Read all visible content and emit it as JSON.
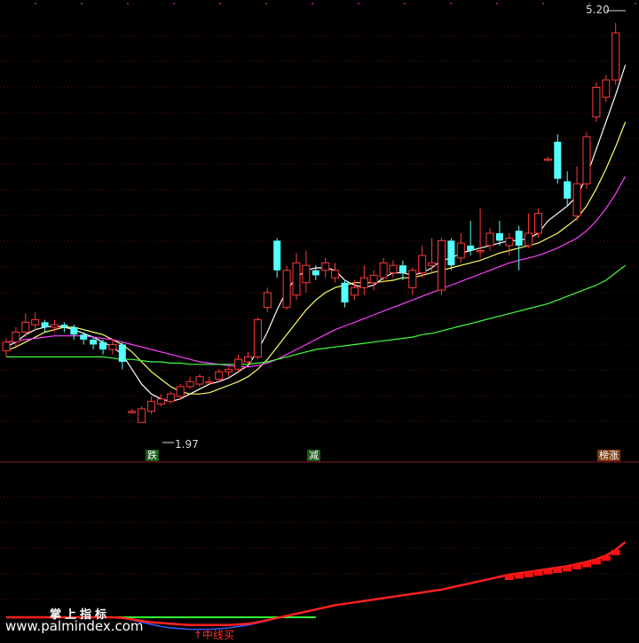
{
  "chart_data": {
    "type": "candlestick",
    "price_range": [
      1.8,
      5.3
    ],
    "annotations": {
      "high": "5.20",
      "low": "1.97"
    },
    "candles": [
      {
        "o": 2.55,
        "c": 2.62,
        "h": 2.65,
        "l": 2.5,
        "up": true
      },
      {
        "o": 2.62,
        "c": 2.7,
        "h": 2.74,
        "l": 2.58,
        "up": true
      },
      {
        "o": 2.7,
        "c": 2.78,
        "h": 2.85,
        "l": 2.66,
        "up": true
      },
      {
        "o": 2.76,
        "c": 2.8,
        "h": 2.86,
        "l": 2.72,
        "up": true
      },
      {
        "o": 2.78,
        "c": 2.74,
        "h": 2.8,
        "l": 2.7,
        "up": false
      },
      {
        "o": 2.74,
        "c": 2.76,
        "h": 2.8,
        "l": 2.7,
        "up": true
      },
      {
        "o": 2.76,
        "c": 2.74,
        "h": 2.78,
        "l": 2.7,
        "up": false
      },
      {
        "o": 2.74,
        "c": 2.68,
        "h": 2.76,
        "l": 2.64,
        "up": false
      },
      {
        "o": 2.68,
        "c": 2.64,
        "h": 2.7,
        "l": 2.6,
        "up": false
      },
      {
        "o": 2.64,
        "c": 2.6,
        "h": 2.66,
        "l": 2.56,
        "up": false
      },
      {
        "o": 2.62,
        "c": 2.56,
        "h": 2.64,
        "l": 2.52,
        "up": false
      },
      {
        "o": 2.56,
        "c": 2.6,
        "h": 2.64,
        "l": 2.52,
        "up": true
      },
      {
        "o": 2.6,
        "c": 2.46,
        "h": 2.62,
        "l": 2.4,
        "up": false
      },
      {
        "o": 2.06,
        "c": 2.06,
        "h": 2.08,
        "l": 2.04,
        "up": true
      },
      {
        "o": 1.97,
        "c": 2.08,
        "h": 2.1,
        "l": 1.97,
        "up": true
      },
      {
        "o": 2.06,
        "c": 2.14,
        "h": 2.18,
        "l": 2.04,
        "up": true
      },
      {
        "o": 2.12,
        "c": 2.16,
        "h": 2.2,
        "l": 2.1,
        "up": true
      },
      {
        "o": 2.14,
        "c": 2.2,
        "h": 2.22,
        "l": 2.12,
        "up": true
      },
      {
        "o": 2.18,
        "c": 2.26,
        "h": 2.28,
        "l": 2.16,
        "up": true
      },
      {
        "o": 2.26,
        "c": 2.3,
        "h": 2.34,
        "l": 2.24,
        "up": true
      },
      {
        "o": 2.28,
        "c": 2.34,
        "h": 2.36,
        "l": 2.26,
        "up": true
      },
      {
        "o": 2.3,
        "c": 2.3,
        "h": 2.34,
        "l": 2.28,
        "up": true
      },
      {
        "o": 2.32,
        "c": 2.38,
        "h": 2.4,
        "l": 2.3,
        "up": true
      },
      {
        "o": 2.38,
        "c": 2.4,
        "h": 2.42,
        "l": 2.34,
        "up": true
      },
      {
        "o": 2.4,
        "c": 2.48,
        "h": 2.52,
        "l": 2.38,
        "up": true
      },
      {
        "o": 2.46,
        "c": 2.5,
        "h": 2.54,
        "l": 2.44,
        "up": true
      },
      {
        "o": 2.5,
        "c": 2.8,
        "h": 2.82,
        "l": 2.48,
        "up": true
      },
      {
        "o": 2.9,
        "c": 3.02,
        "h": 3.06,
        "l": 2.86,
        "up": true
      },
      {
        "o": 3.44,
        "c": 3.2,
        "h": 3.46,
        "l": 3.14,
        "up": false
      },
      {
        "o": 2.9,
        "c": 3.2,
        "h": 3.24,
        "l": 2.88,
        "up": true
      },
      {
        "o": 3.0,
        "c": 3.26,
        "h": 3.34,
        "l": 2.96,
        "up": true
      },
      {
        "o": 3.1,
        "c": 3.24,
        "h": 3.36,
        "l": 3.02,
        "up": true
      },
      {
        "o": 3.2,
        "c": 3.16,
        "h": 3.24,
        "l": 3.12,
        "up": false
      },
      {
        "o": 3.2,
        "c": 3.26,
        "h": 3.3,
        "l": 3.14,
        "up": true
      },
      {
        "o": 3.14,
        "c": 3.2,
        "h": 3.26,
        "l": 3.1,
        "up": true
      },
      {
        "o": 3.1,
        "c": 2.94,
        "h": 3.12,
        "l": 2.9,
        "up": false
      },
      {
        "o": 3.0,
        "c": 3.06,
        "h": 3.12,
        "l": 2.96,
        "up": true
      },
      {
        "o": 3.06,
        "c": 3.14,
        "h": 3.24,
        "l": 3.0,
        "up": true
      },
      {
        "o": 3.1,
        "c": 3.16,
        "h": 3.2,
        "l": 3.04,
        "up": true
      },
      {
        "o": 3.14,
        "c": 3.26,
        "h": 3.3,
        "l": 3.1,
        "up": true
      },
      {
        "o": 3.18,
        "c": 3.24,
        "h": 3.28,
        "l": 3.14,
        "up": true
      },
      {
        "o": 3.24,
        "c": 3.18,
        "h": 3.28,
        "l": 3.12,
        "up": false
      },
      {
        "o": 3.06,
        "c": 3.2,
        "h": 3.22,
        "l": 3.0,
        "up": true
      },
      {
        "o": 3.18,
        "c": 3.32,
        "h": 3.4,
        "l": 3.14,
        "up": true
      },
      {
        "o": 3.24,
        "c": 3.26,
        "h": 3.46,
        "l": 3.18,
        "up": true
      },
      {
        "o": 3.04,
        "c": 3.44,
        "h": 3.46,
        "l": 3.0,
        "up": true
      },
      {
        "o": 3.44,
        "c": 3.24,
        "h": 3.46,
        "l": 3.2,
        "up": false
      },
      {
        "o": 3.3,
        "c": 3.42,
        "h": 3.5,
        "l": 3.26,
        "up": true
      },
      {
        "o": 3.4,
        "c": 3.36,
        "h": 3.6,
        "l": 3.32,
        "up": false
      },
      {
        "o": 3.36,
        "c": 3.36,
        "h": 3.7,
        "l": 3.3,
        "up": true
      },
      {
        "o": 3.4,
        "c": 3.5,
        "h": 3.54,
        "l": 3.36,
        "up": true
      },
      {
        "o": 3.5,
        "c": 3.44,
        "h": 3.6,
        "l": 3.4,
        "up": false
      },
      {
        "o": 3.4,
        "c": 3.46,
        "h": 3.5,
        "l": 3.32,
        "up": true
      },
      {
        "o": 3.52,
        "c": 3.4,
        "h": 3.56,
        "l": 3.2,
        "up": false
      },
      {
        "o": 3.4,
        "c": 3.5,
        "h": 3.66,
        "l": 3.38,
        "up": true
      },
      {
        "o": 3.5,
        "c": 3.66,
        "h": 3.7,
        "l": 3.46,
        "up": true
      },
      {
        "o": 4.1,
        "c": 4.1,
        "h": 4.12,
        "l": 4.08,
        "up": true
      },
      {
        "o": 4.24,
        "c": 3.94,
        "h": 4.3,
        "l": 3.9,
        "up": false
      },
      {
        "o": 3.92,
        "c": 3.78,
        "h": 4.0,
        "l": 3.72,
        "up": false
      },
      {
        "o": 3.64,
        "c": 3.9,
        "h": 4.04,
        "l": 3.6,
        "up": true
      },
      {
        "o": 3.9,
        "c": 4.28,
        "h": 4.32,
        "l": 3.86,
        "up": true
      },
      {
        "o": 4.44,
        "c": 4.68,
        "h": 4.72,
        "l": 4.4,
        "up": true
      },
      {
        "o": 4.6,
        "c": 4.74,
        "h": 4.78,
        "l": 4.56,
        "up": true
      },
      {
        "o": 4.74,
        "c": 5.12,
        "h": 5.2,
        "l": 4.7,
        "up": true
      }
    ],
    "ma_lines": [
      {
        "color": "#ffffff",
        "values": [
          2.58,
          2.62,
          2.68,
          2.72,
          2.74,
          2.75,
          2.74,
          2.72,
          2.69,
          2.66,
          2.62,
          2.58,
          2.52,
          2.4,
          2.28,
          2.2,
          2.16,
          2.14,
          2.16,
          2.2,
          2.24,
          2.28,
          2.3,
          2.33,
          2.38,
          2.43,
          2.55,
          2.7,
          2.88,
          3.04,
          3.14,
          3.2,
          3.22,
          3.22,
          3.2,
          3.12,
          3.08,
          3.06,
          3.08,
          3.14,
          3.18,
          3.18,
          3.16,
          3.18,
          3.22,
          3.28,
          3.3,
          3.34,
          3.36,
          3.38,
          3.4,
          3.42,
          3.44,
          3.44,
          3.46,
          3.5,
          3.6,
          3.66,
          3.72,
          3.8,
          3.96,
          4.18,
          4.4,
          4.62,
          4.86
        ]
      },
      {
        "color": "#ffff66",
        "values": [
          2.55,
          2.58,
          2.62,
          2.66,
          2.7,
          2.72,
          2.74,
          2.74,
          2.72,
          2.7,
          2.68,
          2.64,
          2.6,
          2.54,
          2.46,
          2.38,
          2.32,
          2.26,
          2.22,
          2.2,
          2.2,
          2.21,
          2.24,
          2.27,
          2.3,
          2.34,
          2.4,
          2.48,
          2.58,
          2.68,
          2.78,
          2.88,
          2.96,
          3.02,
          3.06,
          3.08,
          3.1,
          3.1,
          3.1,
          3.11,
          3.12,
          3.14,
          3.14,
          3.16,
          3.18,
          3.2,
          3.22,
          3.24,
          3.26,
          3.28,
          3.31,
          3.34,
          3.36,
          3.38,
          3.4,
          3.42,
          3.46,
          3.5,
          3.56,
          3.62,
          3.72,
          3.86,
          4.02,
          4.2,
          4.4
        ]
      },
      {
        "color": "#ff40ff",
        "values": [
          2.62,
          2.63,
          2.64,
          2.65,
          2.66,
          2.67,
          2.67,
          2.67,
          2.67,
          2.66,
          2.65,
          2.64,
          2.62,
          2.6,
          2.58,
          2.56,
          2.54,
          2.52,
          2.5,
          2.48,
          2.46,
          2.45,
          2.44,
          2.43,
          2.42,
          2.42,
          2.43,
          2.45,
          2.48,
          2.52,
          2.56,
          2.6,
          2.64,
          2.68,
          2.72,
          2.75,
          2.78,
          2.81,
          2.84,
          2.87,
          2.9,
          2.93,
          2.96,
          2.99,
          3.02,
          3.05,
          3.08,
          3.11,
          3.14,
          3.17,
          3.2,
          3.23,
          3.26,
          3.28,
          3.3,
          3.32,
          3.35,
          3.38,
          3.42,
          3.46,
          3.52,
          3.6,
          3.7,
          3.82,
          3.96
        ]
      },
      {
        "color": "#40ff40",
        "values": [
          2.5,
          2.5,
          2.5,
          2.5,
          2.5,
          2.5,
          2.5,
          2.5,
          2.5,
          2.5,
          2.5,
          2.49,
          2.48,
          2.48,
          2.47,
          2.46,
          2.46,
          2.45,
          2.45,
          2.44,
          2.44,
          2.44,
          2.44,
          2.44,
          2.44,
          2.44,
          2.45,
          2.46,
          2.48,
          2.5,
          2.52,
          2.54,
          2.56,
          2.57,
          2.58,
          2.59,
          2.6,
          2.61,
          2.62,
          2.63,
          2.64,
          2.65,
          2.66,
          2.68,
          2.69,
          2.71,
          2.73,
          2.75,
          2.77,
          2.79,
          2.81,
          2.83,
          2.85,
          2.87,
          2.89,
          2.91,
          2.93,
          2.96,
          2.99,
          3.02,
          3.05,
          3.08,
          3.12,
          3.18,
          3.24
        ]
      }
    ],
    "signals": [
      {
        "label": "跌",
        "index": 13
      },
      {
        "label": "减",
        "index": 29
      },
      {
        "label": "榜涨",
        "index": 58
      }
    ],
    "sub_indicator": {
      "red_line": [
        0.1,
        0.1,
        0.1,
        0.1,
        0.1,
        0.1,
        0.1,
        0.1,
        0.1,
        0.1,
        0.1,
        0.1,
        0.09,
        0.07,
        0.05,
        0.03,
        0.02,
        0.01,
        0.0,
        -0.01,
        -0.01,
        -0.01,
        -0.01,
        -0.01,
        0.0,
        0.01,
        0.03,
        0.06,
        0.09,
        0.12,
        0.15,
        0.18,
        0.21,
        0.24,
        0.27,
        0.29,
        0.31,
        0.33,
        0.35,
        0.37,
        0.39,
        0.41,
        0.43,
        0.45,
        0.47,
        0.49,
        0.52,
        0.55,
        0.58,
        0.61,
        0.64,
        0.67,
        0.7,
        0.72,
        0.74,
        0.76,
        0.78,
        0.8,
        0.82,
        0.85,
        0.88,
        0.92,
        0.97,
        1.05,
        1.16
      ],
      "green_line": [
        0.1,
        0.1,
        0.1,
        0.1,
        0.1,
        0.1,
        0.1,
        0.1,
        0.1,
        0.1,
        0.1,
        0.1,
        0.1,
        0.1,
        0.1,
        0.1,
        0.1,
        0.1,
        0.1,
        0.1,
        0.1,
        0.1,
        0.1,
        0.1,
        0.1,
        0.1,
        0.1,
        0.1,
        0.1,
        0.1,
        0.1,
        0.1,
        0.1
      ],
      "blue_line": [
        0.1,
        0.1,
        0.1,
        0.1,
        0.1,
        0.1,
        0.1,
        0.1,
        0.1,
        0.1,
        0.1,
        0.1,
        0.09,
        0.06,
        0.03,
        0.0,
        -0.03,
        -0.05,
        -0.06,
        -0.07,
        -0.07,
        -0.07,
        -0.06,
        -0.05,
        -0.03,
        -0.01,
        0.02,
        0.05
      ],
      "range": [
        -0.2,
        1.3
      ]
    },
    "watermark": {
      "cn": "掌上指标",
      "url": "www.palmindex.com"
    },
    "buy_label": "↑中线买"
  }
}
